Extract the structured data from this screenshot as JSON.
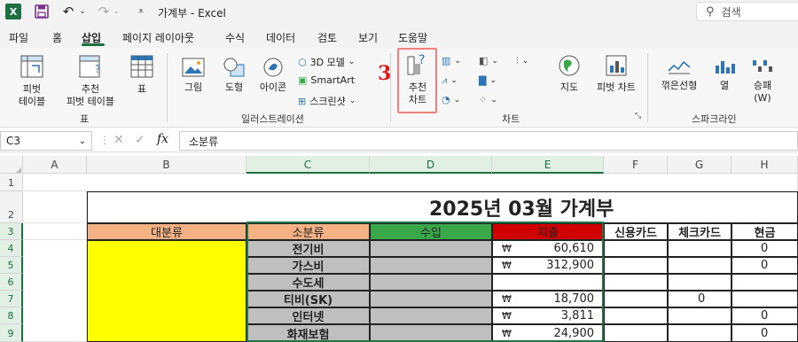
{
  "titlebar": {
    "app_logo": "X",
    "title": "가계부  -  Excel",
    "search_placeholder": "검색"
  },
  "menu": {
    "tabs": [
      "파일",
      "홈",
      "삽입",
      "페이지 레이아웃",
      "수식",
      "데이터",
      "검토",
      "보기",
      "도움말"
    ],
    "active": "삽입"
  },
  "ribbon": {
    "pivot_table": "피벗\n테이블",
    "recommended_pivot": "추천\n피벗 테이블",
    "table": "표",
    "group_table": "표",
    "picture": "그림",
    "shapes": "도형",
    "icons": "아이콘",
    "models_3d": "3D 모델",
    "smartart": "SmartArt",
    "screenshot": "스크린샷",
    "group_illustration": "일러스트레이션",
    "recommended_charts": "추천\n차트",
    "maps": "지도",
    "pivot_chart": "피벗 차트",
    "group_chart": "차트",
    "spark_line": "꺾은선형",
    "spark_column": "열",
    "spark_winloss": "승패\n(W)",
    "group_sparkline": "스파크라인",
    "step_number": "3"
  },
  "formula_bar": {
    "name_box": "C3",
    "formula": "소분류"
  },
  "grid": {
    "columns": [
      "A",
      "B",
      "C",
      "D",
      "E",
      "F",
      "G",
      "H"
    ],
    "rows": [
      "1",
      "2",
      "3",
      "4",
      "5",
      "6",
      "7",
      "8",
      "9"
    ],
    "title": "2025년 03월 가계부",
    "headers": {
      "major_category": "대분류",
      "minor_category": "소분류",
      "income": "수입",
      "expense": "지출",
      "credit_card": "신용카드",
      "check_card": "체크카드",
      "cash": "현금"
    },
    "currency_symbol": "₩",
    "data_rows": [
      {
        "minor": "전기비",
        "expense": "60,610",
        "credit": "",
        "check": "",
        "cash": "0"
      },
      {
        "minor": "가스비",
        "expense": "312,900",
        "credit": "",
        "check": "",
        "cash": "0"
      },
      {
        "minor": "수도세",
        "expense": "",
        "credit": "",
        "check": "",
        "cash": ""
      },
      {
        "minor": "티비(SK)",
        "expense": "18,700",
        "credit": "",
        "check": "0",
        "cash": ""
      },
      {
        "minor": "인터넷",
        "expense": "3,811",
        "credit": "",
        "check": "",
        "cash": "0"
      },
      {
        "minor": "화재보험",
        "expense": "24,900",
        "credit": "",
        "check": "",
        "cash": "0"
      }
    ]
  },
  "colors": {
    "excel_green": "#1d6f42",
    "header_salmon": "#f4b183",
    "header_green": "#3aa84a",
    "header_red": "#d00000",
    "yellow": "#ffff00",
    "gray_cell": "#bfbfbf",
    "step_red": "#e0191c"
  }
}
